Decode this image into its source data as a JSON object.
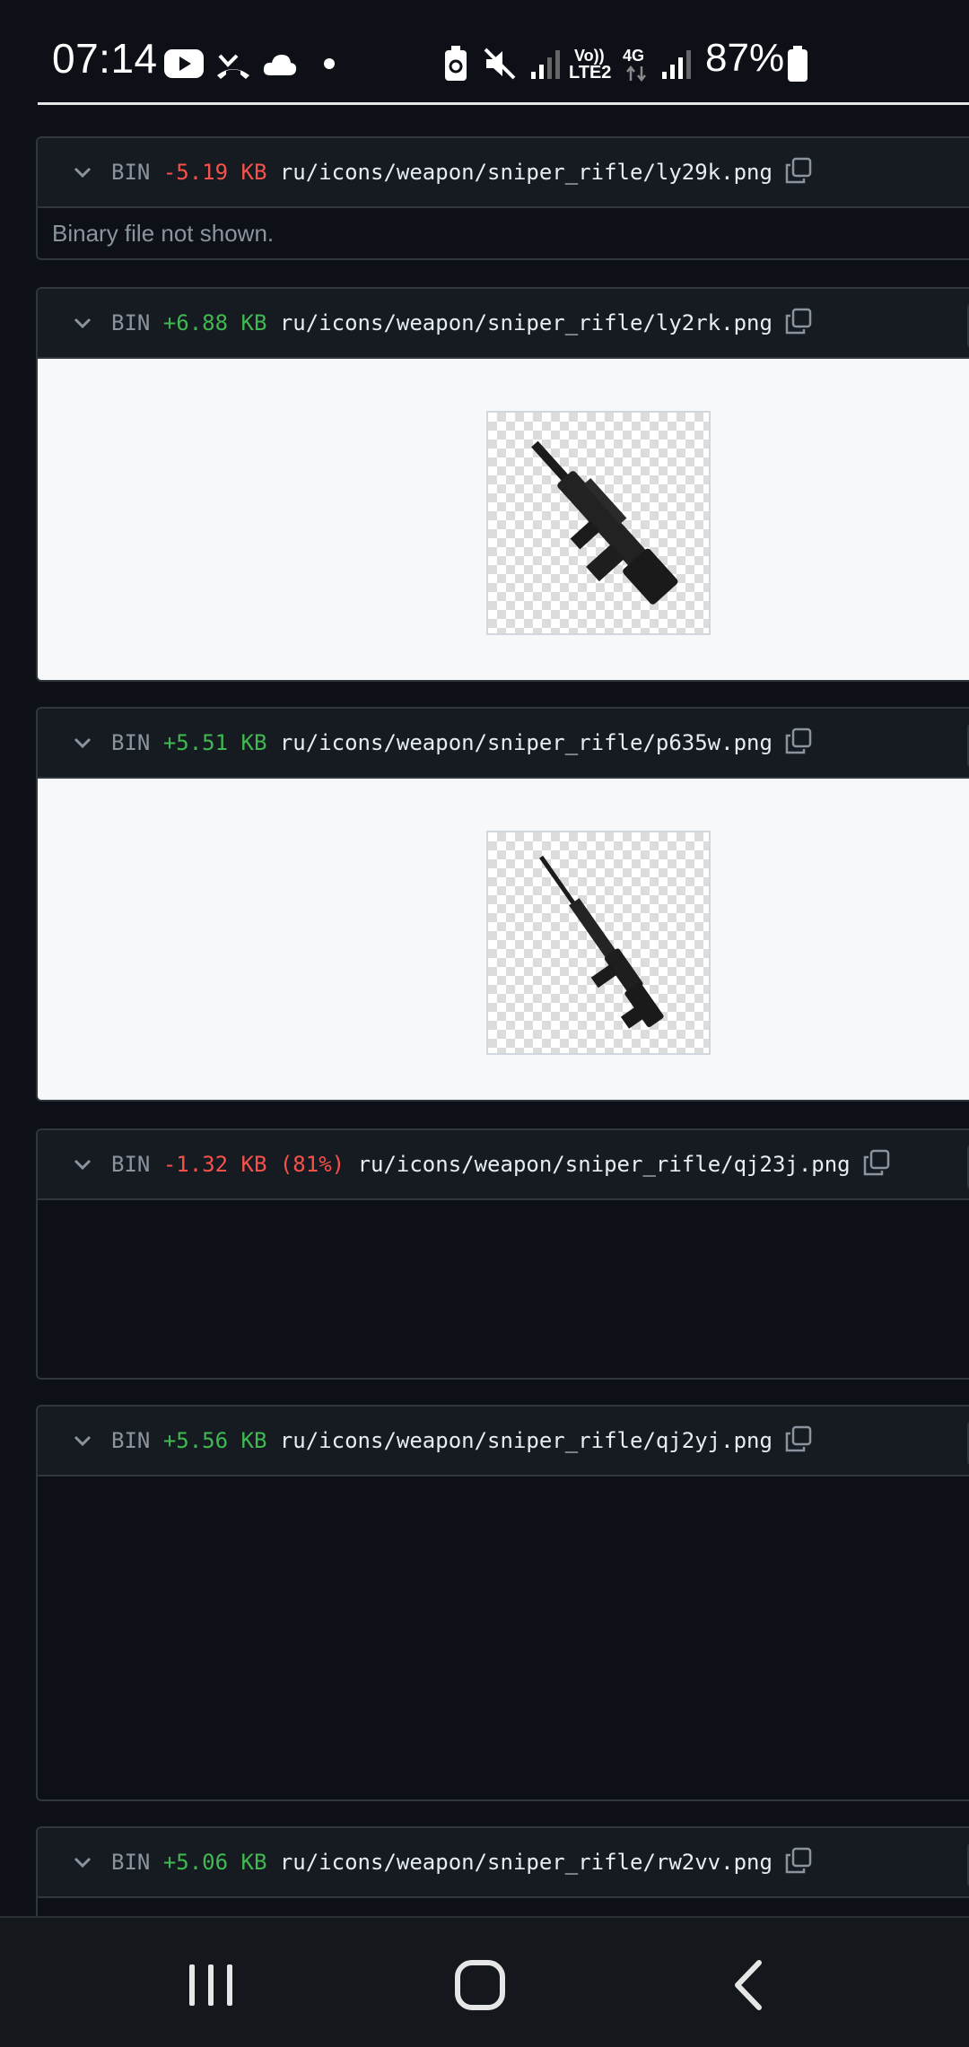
{
  "status_bar": {
    "time": "07:14",
    "network_volte": "Vo))",
    "network_lte": "LTE2",
    "network_4g": "4G",
    "battery_percent": "87%",
    "icons": [
      "youtube-icon",
      "missed-call-icon",
      "cloud-icon",
      "dot-icon",
      "battery-saver-icon",
      "mute-icon",
      "signal-icon",
      "signal-icon-2",
      "battery-icon"
    ]
  },
  "colors": {
    "deletion": "#f85149",
    "addition": "#3fb950",
    "background": "#0d1117",
    "header": "#161b22"
  },
  "files": [
    {
      "bin": "BIN",
      "size": "-5.19 KB",
      "path": "ru/icons/weapon/sniper_rifle/ly29k.png",
      "note": "Binary file not shown."
    },
    {
      "bin": "BIN",
      "size": "+6.88 KB",
      "path": "ru/icons/weapon/sniper_rifle/ly2rk.png"
    },
    {
      "bin": "BIN",
      "size": "+5.51 KB",
      "path": "ru/icons/weapon/sniper_rifle/p635w.png"
    },
    {
      "bin": "BIN",
      "size": "-1.32 KB (81%)",
      "path": "ru/icons/weapon/sniper_rifle/qj23j.png"
    },
    {
      "bin": "BIN",
      "size": "+5.56 KB",
      "path": "ru/icons/weapon/sniper_rifle/qj2yj.png"
    },
    {
      "bin": "BIN",
      "size": "+5.06 KB",
      "path": "ru/icons/weapon/sniper_rifle/rw2vv.png"
    }
  ],
  "nav": {
    "icons": [
      "recent-apps-icon",
      "home-icon",
      "back-icon"
    ]
  }
}
